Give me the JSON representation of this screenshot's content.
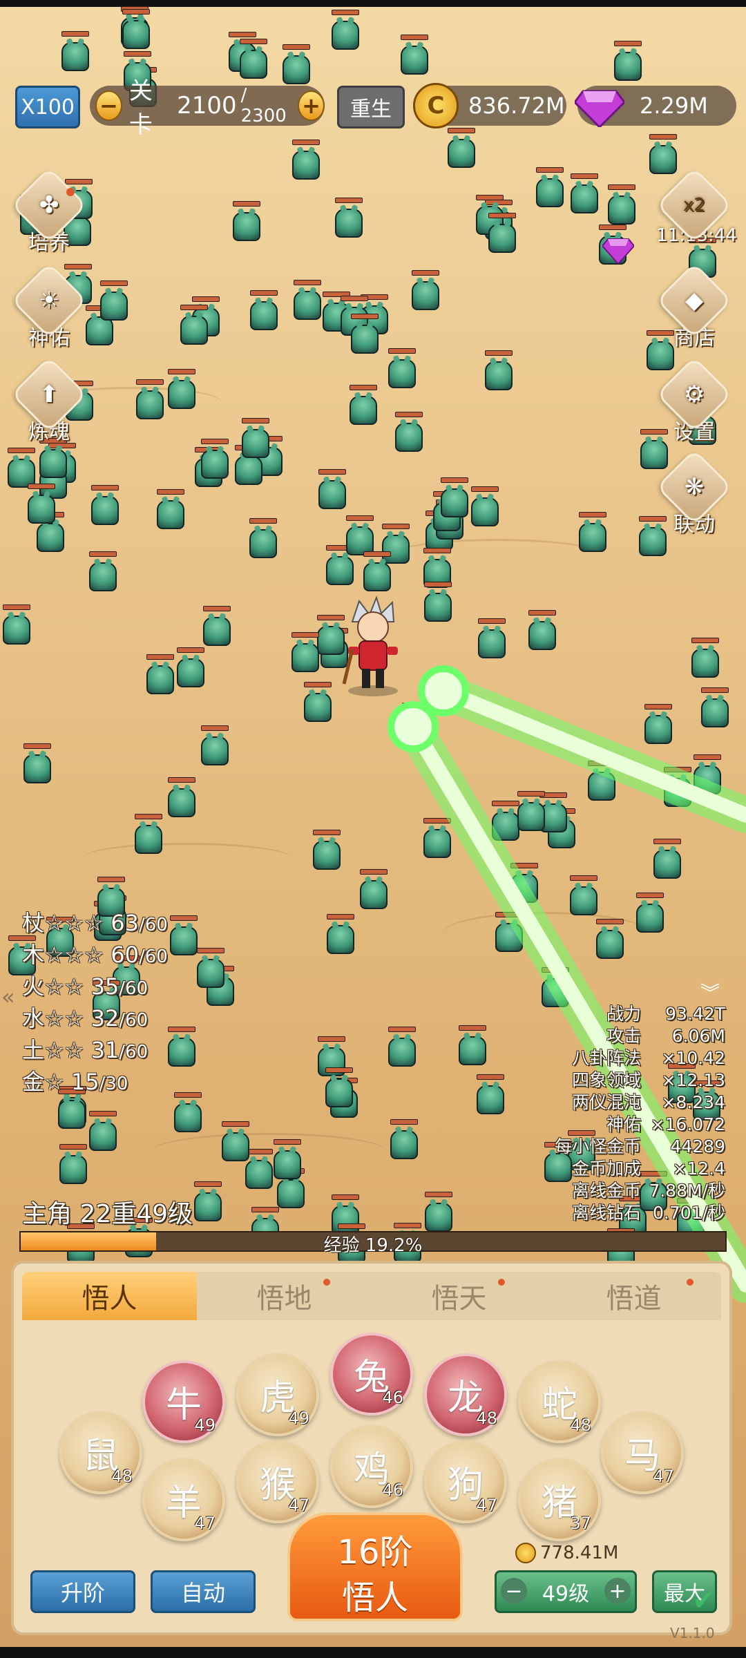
{
  "top_bar": {
    "speed_label": "X100",
    "stage_label": "关卡",
    "stage_current": "2100",
    "stage_total": "/ 2300",
    "rebirth_label": "重生",
    "gold": "836.72M",
    "gems": "2.29M"
  },
  "left_menu": [
    {
      "label": "培养",
      "icon": "clover-icon"
    },
    {
      "label": "神佑",
      "icon": "sun-icon"
    },
    {
      "label": "炼魂",
      "icon": "arrow-up-icon"
    }
  ],
  "right_menu": {
    "boost_label": "x2",
    "boost_timer": "11:13:44",
    "items": [
      {
        "label": "商店",
        "icon": "gem-icon"
      },
      {
        "label": "设置",
        "icon": "gear-icon"
      },
      {
        "label": "联动",
        "icon": "fan-icon"
      }
    ]
  },
  "weapons": [
    {
      "name": "杖☆☆☆",
      "value": "63",
      "max": "/60"
    },
    {
      "name": "木☆☆☆",
      "value": "60",
      "max": "/60"
    },
    {
      "name": "火☆☆",
      "value": "35",
      "max": "/60"
    },
    {
      "name": "水☆☆",
      "value": "32",
      "max": "/60"
    },
    {
      "name": "土☆☆",
      "value": "31",
      "max": "/60"
    },
    {
      "name": "金☆",
      "value": "15",
      "max": "/30"
    }
  ],
  "stats": [
    {
      "key": "战力",
      "value": "93.42T"
    },
    {
      "key": "攻击",
      "value": "6.06M"
    },
    {
      "key": "八卦阵法",
      "value": "×10.42"
    },
    {
      "key": "四象领域",
      "value": "×12.13"
    },
    {
      "key": "两仪混沌",
      "value": "×8.234"
    },
    {
      "key": "神佑",
      "value": "×16.072"
    },
    {
      "key": "每小怪金币",
      "value": "44289"
    },
    {
      "key": "金币加成",
      "value": "×12.4"
    },
    {
      "key": "离线金币",
      "value": "7.88M/秒"
    },
    {
      "key": "离线钻石",
      "value": "0.701/秒"
    }
  ],
  "hero": {
    "level_label": "主角 22重49级",
    "exp_label": "经验 19.2%",
    "exp_fraction": 0.192
  },
  "tabs": [
    "悟人",
    "悟地",
    "悟天",
    "悟道"
  ],
  "zodiacs": [
    {
      "name": "rat",
      "glyph": "鼠",
      "level": "48",
      "red": false
    },
    {
      "name": "ox",
      "glyph": "牛",
      "level": "49",
      "red": true
    },
    {
      "name": "tiger",
      "glyph": "虎",
      "level": "49",
      "red": false
    },
    {
      "name": "rabbit",
      "glyph": "兔",
      "level": "46",
      "red": true
    },
    {
      "name": "dragon",
      "glyph": "龙",
      "level": "48",
      "red": true
    },
    {
      "name": "snake",
      "glyph": "蛇",
      "level": "48",
      "red": false
    },
    {
      "name": "horse",
      "glyph": "马",
      "level": "47",
      "red": false
    },
    {
      "name": "goat",
      "glyph": "羊",
      "level": "47",
      "red": false
    },
    {
      "name": "monkey",
      "glyph": "猴",
      "level": "47",
      "red": false
    },
    {
      "name": "rooster",
      "glyph": "鸡",
      "level": "46",
      "red": false
    },
    {
      "name": "dog",
      "glyph": "狗",
      "level": "47",
      "red": false
    },
    {
      "name": "pig",
      "glyph": "猪",
      "level": "37",
      "red": false
    }
  ],
  "bottom": {
    "upgrade_label": "升阶",
    "auto_label": "自动",
    "center_line1": "16阶",
    "center_line2": "悟人",
    "cost": "778.41M",
    "level": "49级",
    "max_label": "最大",
    "version": "V1.1.0"
  },
  "colors": {
    "laser": "#6dff6a",
    "exp_fill": "#f7a13a",
    "active_tab": "#f3a93c"
  }
}
